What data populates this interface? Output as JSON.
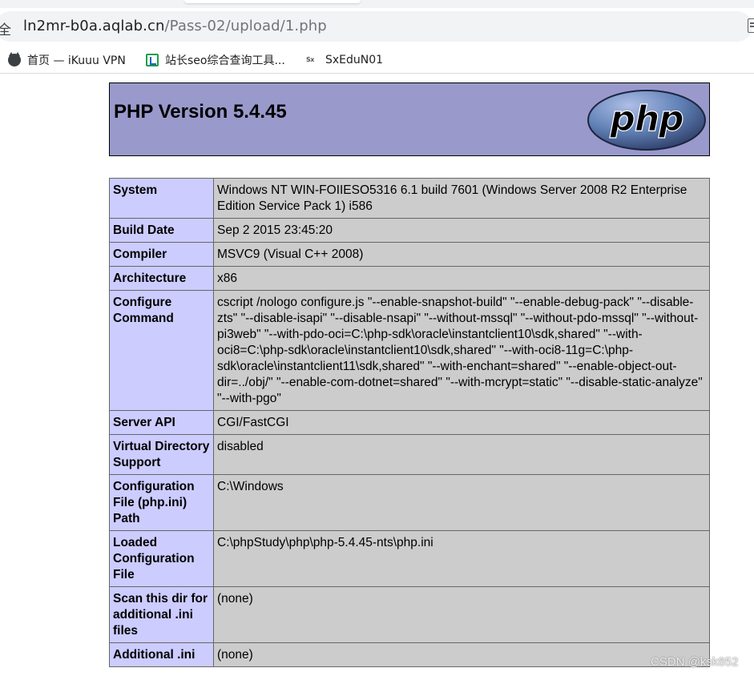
{
  "browser": {
    "security_glyph": "全",
    "url_host": "ln2mr-b0a.aqlab.cn",
    "url_path": "/Pass-02/upload/1.php",
    "bookmarks": [
      {
        "label": "首页 — iKuuu VPN",
        "icon": "cat-icon"
      },
      {
        "label": "站长seo综合查询工具...",
        "icon": "chart-icon"
      },
      {
        "label": "SxEduN01",
        "icon": "sx-icon"
      }
    ]
  },
  "phpinfo": {
    "title": "PHP Version 5.4.45",
    "logo_text": "php",
    "rows": [
      {
        "key": "System",
        "value": "Windows NT WIN-FOIIESO5316 6.1 build 7601 (Windows Server 2008 R2 Enterprise Edition Service Pack 1) i586"
      },
      {
        "key": "Build Date",
        "value": "Sep 2 2015 23:45:20"
      },
      {
        "key": "Compiler",
        "value": "MSVC9 (Visual C++ 2008)"
      },
      {
        "key": "Architecture",
        "value": "x86"
      },
      {
        "key": "Configure Command",
        "value": "cscript /nologo configure.js \"--enable-snapshot-build\" \"--enable-debug-pack\" \"--disable-zts\" \"--disable-isapi\" \"--disable-nsapi\" \"--without-mssql\" \"--without-pdo-mssql\" \"--without-pi3web\" \"--with-pdo-oci=C:\\php-sdk\\oracle\\instantclient10\\sdk,shared\" \"--with-oci8=C:\\php-sdk\\oracle\\instantclient10\\sdk,shared\" \"--with-oci8-11g=C:\\php-sdk\\oracle\\instantclient11\\sdk,shared\" \"--with-enchant=shared\" \"--enable-object-out-dir=../obj/\" \"--enable-com-dotnet=shared\" \"--with-mcrypt=static\" \"--disable-static-analyze\" \"--with-pgo\""
      },
      {
        "key": "Server API",
        "value": "CGI/FastCGI"
      },
      {
        "key": "Virtual Directory Support",
        "value": "disabled"
      },
      {
        "key": "Configuration File (php.ini) Path",
        "value": "C:\\Windows"
      },
      {
        "key": "Loaded Configuration File",
        "value": "C:\\phpStudy\\php\\php-5.4.45-nts\\php.ini"
      },
      {
        "key": "Scan this dir for additional .ini files",
        "value": "(none)"
      },
      {
        "key": "Additional .ini",
        "value": "(none)"
      }
    ]
  },
  "watermark": "CSDN @ksk852",
  "colors": {
    "header_bg": "#9999cc",
    "key_cell_bg": "#ccccff",
    "value_cell_bg": "#cccccc",
    "logo_oval": "#6181b6",
    "logo_text": "#000000"
  }
}
